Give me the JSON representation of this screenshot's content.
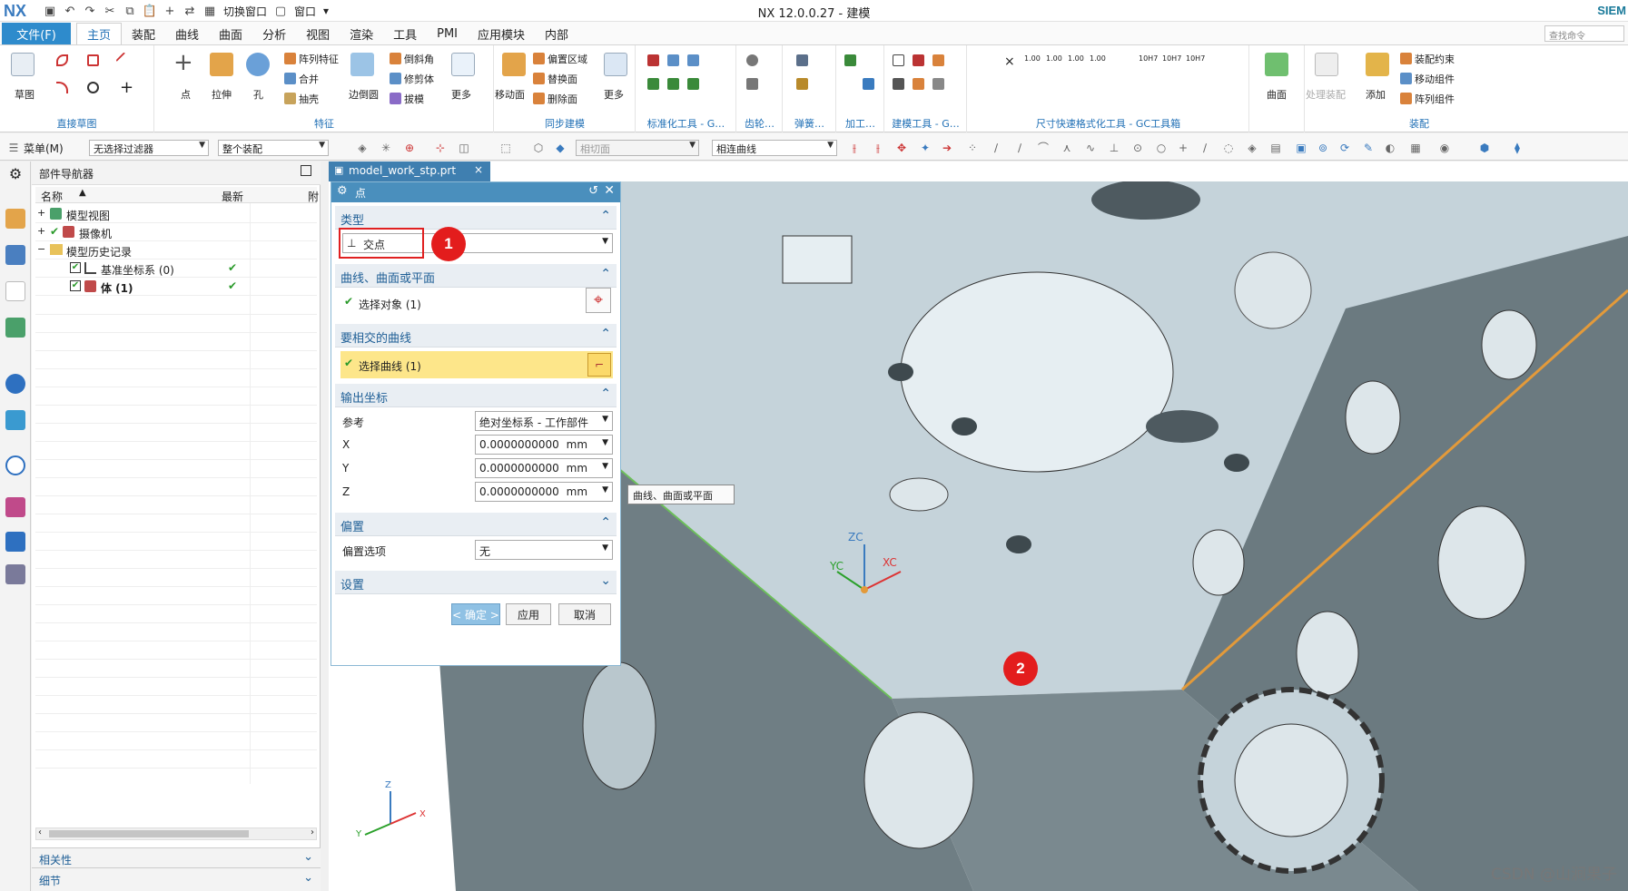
{
  "app": {
    "logo": "NX",
    "title": "NX 12.0.0.27 - 建模",
    "brand": "SIEM",
    "switch_window": "切换窗口",
    "window_menu": "窗口",
    "command_search_placeholder": "查找命令"
  },
  "menu": {
    "file": "文件(F)",
    "tabs": [
      "主页",
      "装配",
      "曲线",
      "曲面",
      "分析",
      "视图",
      "渲染",
      "工具",
      "PMI",
      "应用模块",
      "内部"
    ],
    "active_tab": "主页"
  },
  "ribbon": {
    "groups": [
      {
        "label": "直接草图",
        "items": [
          "草图"
        ]
      },
      {
        "label": "特征",
        "items": [
          "点",
          "拉伸",
          "孔",
          "阵列特征",
          "合并",
          "抽壳",
          "边倒圆",
          "倒斜角",
          "修剪体",
          "拔模",
          "更多"
        ]
      },
      {
        "label": "同步建模",
        "items": [
          "移动面",
          "偏置区域",
          "替换面",
          "删除面",
          "更多"
        ]
      },
      {
        "label": "标准化工具 - G…",
        "items": []
      },
      {
        "label": "齿轮…",
        "items": []
      },
      {
        "label": "弹簧…",
        "items": []
      },
      {
        "label": "加工…",
        "items": []
      },
      {
        "label": "建模工具 - G…",
        "items": []
      },
      {
        "label": "尺寸快速格式化工具 - GC工具箱",
        "items": [
          "1.00",
          "1.00",
          "1.00",
          "1.00",
          "10H7",
          "10H7",
          "10H7"
        ]
      },
      {
        "label": "",
        "items": [
          "曲面"
        ]
      },
      {
        "label": "装配",
        "items": [
          "处理装配",
          "添加",
          "装配约束",
          "移动组件",
          "阵列组件"
        ]
      }
    ]
  },
  "toolbar2": {
    "menu": "菜单(M)",
    "filter": "无选择过滤器",
    "assembly": "整个装配",
    "tangent": "相切面",
    "curve": "相连曲线"
  },
  "navigator": {
    "title": "部件导航器",
    "col_name": "名称",
    "col_latest": "最新",
    "col_extra": "附",
    "rows": [
      {
        "label": "模型视图",
        "latest": ""
      },
      {
        "label": "摄像机",
        "latest": ""
      },
      {
        "label": "模型历史记录",
        "latest": ""
      },
      {
        "label": "基准坐标系 (0)",
        "latest": "✔"
      },
      {
        "label": "体 (1)",
        "latest": "✔"
      }
    ],
    "bottom_sections": [
      "相关性",
      "细节"
    ]
  },
  "viewport": {
    "doc_tab": "model_work_stp.prt",
    "tooltip": "曲线、曲面或平面",
    "axis_labels": [
      "ZC",
      "YC",
      "XC",
      "Z",
      "Y",
      "X"
    ]
  },
  "dialog": {
    "title": "点",
    "sections": {
      "type": {
        "title": "类型",
        "value": "交点"
      },
      "curve": {
        "title": "曲线、曲面或平面",
        "select_label": "选择对象 (1)"
      },
      "intersect": {
        "title": "要相交的曲线",
        "select_label": "选择曲线 (1)"
      },
      "output": {
        "title": "输出坐标",
        "ref_label": "参考",
        "ref_value": "绝对坐标系 - 工作部件",
        "x_label": "X",
        "x_value": "0.0000000000",
        "x_unit": "mm",
        "y_label": "Y",
        "y_value": "0.0000000000",
        "y_unit": "mm",
        "z_label": "Z",
        "z_value": "0.0000000000",
        "z_unit": "mm"
      },
      "offset": {
        "title": "偏置",
        "option_label": "偏置选项",
        "option_value": "无"
      },
      "settings": {
        "title": "设置"
      }
    },
    "ok": "< 确定 >",
    "apply": "应用",
    "cancel": "取消"
  },
  "annotations": {
    "badge1": "1",
    "badge2": "2"
  },
  "watermark": "CSDN @山涧果子",
  "colors": {
    "accent": "#2e8bcc",
    "highlight": "#fde68a",
    "badge": "#e31d1d",
    "model_face": "#c5d3da",
    "model_dark": "#6b7a80"
  }
}
